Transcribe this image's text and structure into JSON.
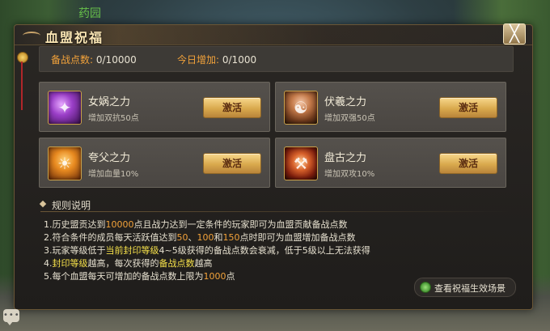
{
  "background_text": "药园",
  "dialog": {
    "title": "血盟祝福",
    "close_label": "╳"
  },
  "stats": {
    "prep_points_label": "备战点数:",
    "prep_points_value": "0/10000",
    "today_added_label": "今日增加:",
    "today_added_value": "0/1000"
  },
  "blessings": [
    {
      "name": "女娲之力",
      "desc": "增加双抗50点",
      "button": "激活",
      "icon": "nvwa-portrait-icon"
    },
    {
      "name": "伏羲之力",
      "desc": "增加双强50点",
      "button": "激活",
      "icon": "fuxi-portrait-icon"
    },
    {
      "name": "夸父之力",
      "desc": "增加血量10%",
      "button": "激活",
      "icon": "kuafu-portrait-icon"
    },
    {
      "name": "盘古之力",
      "desc": "增加双攻10%",
      "button": "激活",
      "icon": "pangu-portrait-icon"
    }
  ],
  "rules": {
    "title": "规则说明",
    "items": [
      [
        {
          "t": "1.历史盟贡达到"
        },
        {
          "t": "10000",
          "c": "orange"
        },
        {
          "t": "点且战力达到一定条件的玩家即可为血盟贡献备战点数"
        }
      ],
      [
        {
          "t": "2.符合条件的成员每天活跃值达到"
        },
        {
          "t": "50",
          "c": "orange"
        },
        {
          "t": "、"
        },
        {
          "t": "100",
          "c": "orange"
        },
        {
          "t": "和"
        },
        {
          "t": "150",
          "c": "orange"
        },
        {
          "t": "点时即可为血盟增加备战点数"
        }
      ],
      [
        {
          "t": "3.玩家等级低于"
        },
        {
          "t": "当前封印等级",
          "c": "yellow"
        },
        {
          "t": "4~5级获得的备战点数会衰减，低于5级以上无法获得"
        }
      ],
      [
        {
          "t": "4."
        },
        {
          "t": "封印等级",
          "c": "yellow"
        },
        {
          "t": "越高，每次获得的"
        },
        {
          "t": "备战点数",
          "c": "yellow"
        },
        {
          "t": "越高"
        }
      ],
      [
        {
          "t": "5.每个血盟每天可增加的备战点数上限为"
        },
        {
          "t": "1000",
          "c": "orange"
        },
        {
          "t": "点"
        }
      ]
    ]
  },
  "scene_button": {
    "label": "查看祝福生效场景"
  },
  "colors": {
    "accent_orange": "#f2a23a",
    "accent_yellow": "#f5e04a",
    "button_gold": "#d9a94d"
  }
}
